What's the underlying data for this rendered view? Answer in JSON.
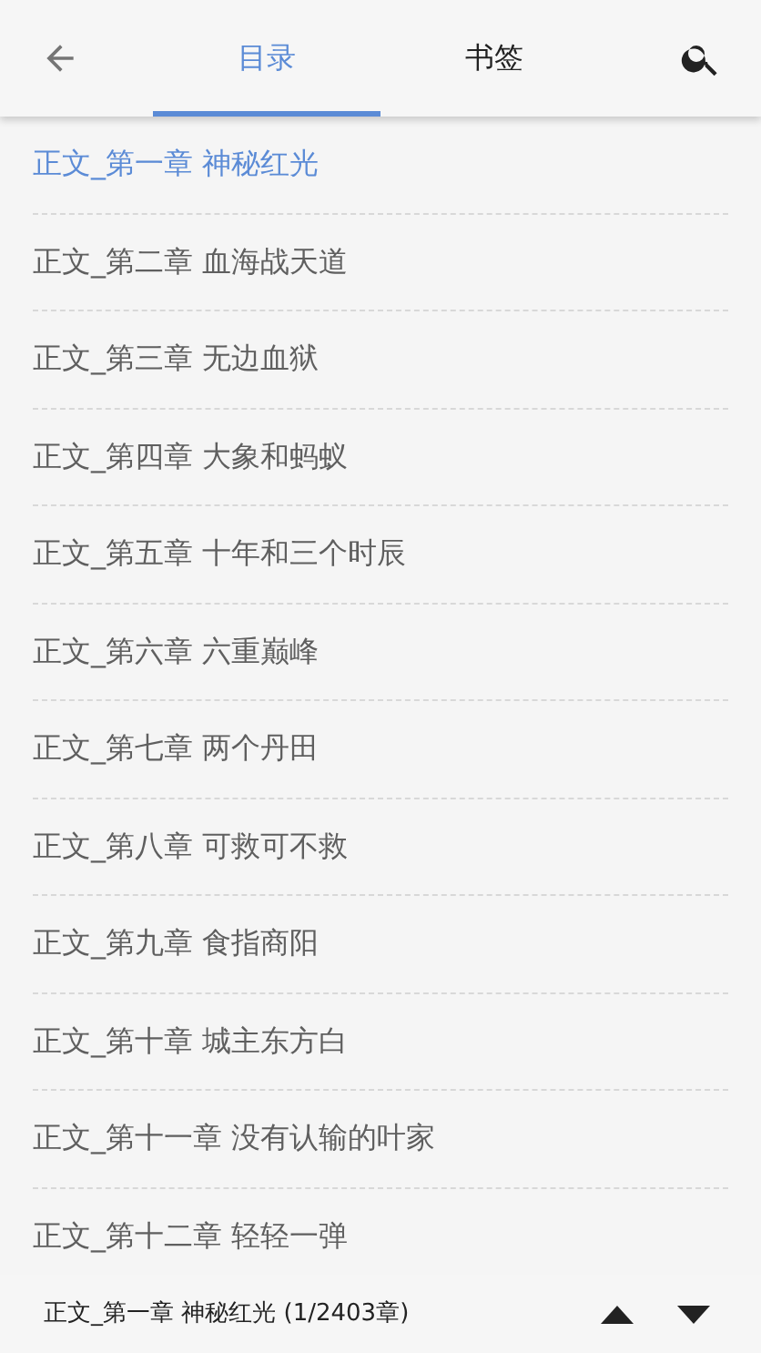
{
  "tabs": [
    {
      "label": "目录",
      "selected": true
    },
    {
      "label": "书签",
      "selected": false
    }
  ],
  "chapters": [
    {
      "title": "正文_第一章 神秘红光",
      "selected": true
    },
    {
      "title": "正文_第二章 血海战天道",
      "selected": false
    },
    {
      "title": "正文_第三章 无边血狱",
      "selected": false
    },
    {
      "title": "正文_第四章 大象和蚂蚁",
      "selected": false
    },
    {
      "title": "正文_第五章 十年和三个时辰",
      "selected": false
    },
    {
      "title": "正文_第六章 六重巅峰",
      "selected": false
    },
    {
      "title": "正文_第七章 两个丹田",
      "selected": false
    },
    {
      "title": "正文_第八章 可救可不救",
      "selected": false
    },
    {
      "title": "正文_第九章 食指商阳",
      "selected": false
    },
    {
      "title": "正文_第十章 城主东方白",
      "selected": false
    },
    {
      "title": "正文_第十一章 没有认输的叶家",
      "selected": false
    },
    {
      "title": "正文_第十二章 轻轻一弹",
      "selected": false
    }
  ],
  "footer": {
    "current": "正文_第一章 神秘红光 (1/2403章)"
  }
}
